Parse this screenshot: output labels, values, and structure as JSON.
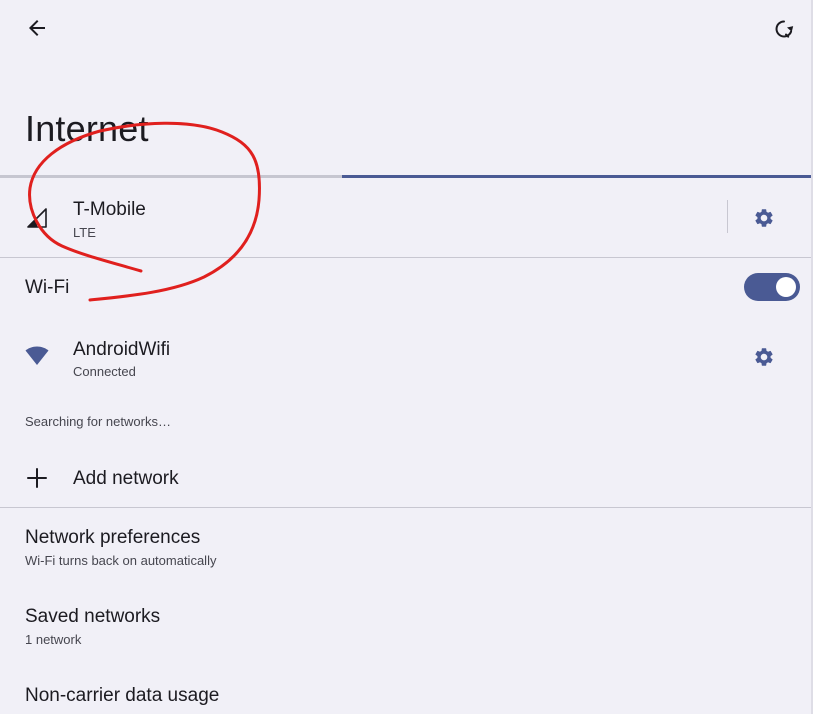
{
  "header": {
    "back_icon": "arrow-back-icon",
    "refresh_icon": "refresh-icon",
    "title": "Internet"
  },
  "progress": {
    "fraction_start": 0.42,
    "fraction_end": 1.0
  },
  "mobile_network": {
    "name": "T-Mobile",
    "type": "LTE",
    "signal_icon": "cellular-signal-icon",
    "settings_icon": "gear-icon"
  },
  "wifi": {
    "label": "Wi-Fi",
    "enabled": true,
    "connected_network": {
      "name": "AndroidWifi",
      "status": "Connected",
      "icon": "wifi-icon",
      "settings_icon": "gear-icon"
    },
    "searching_text": "Searching for networks…",
    "add_network_label": "Add network",
    "add_icon": "plus-icon"
  },
  "settings": [
    {
      "title": "Network preferences",
      "subtitle": "Wi-Fi turns back on automatically"
    },
    {
      "title": "Saved networks",
      "subtitle": "1 network"
    },
    {
      "title": "Non-carrier data usage"
    }
  ],
  "colors": {
    "background": "#f1f0f7",
    "accent": "#4a5a94",
    "annotation": "#e0201e"
  }
}
